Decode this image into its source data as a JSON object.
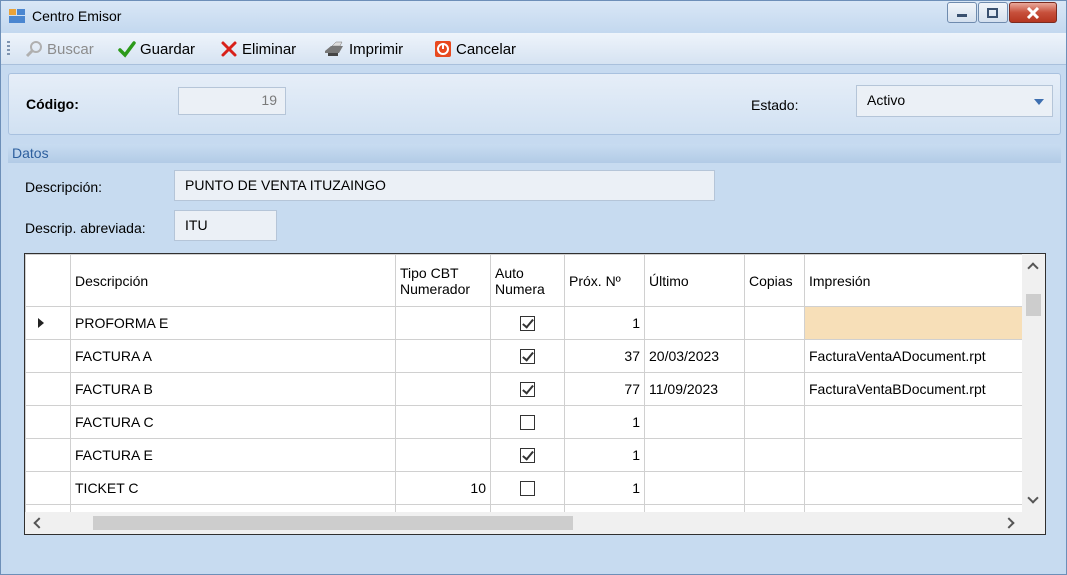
{
  "window": {
    "title": "Centro Emisor",
    "controls": {
      "minimize": "minimize",
      "maximize": "maximize",
      "close": "close"
    }
  },
  "toolbar": {
    "buscar": "Buscar",
    "guardar": "Guardar",
    "eliminar": "Eliminar",
    "imprimir": "Imprimir",
    "cancelar": "Cancelar"
  },
  "header": {
    "codigo_label": "Código:",
    "codigo_value": "19",
    "estado_label": "Estado:",
    "estado_value": "Activo"
  },
  "datos": {
    "section_title": "Datos",
    "descripcion_label": "Descripción:",
    "descripcion_value": "PUNTO DE VENTA ITUZAINGO",
    "abreviada_label": "Descrip. abreviada:",
    "abreviada_value": "ITU"
  },
  "grid": {
    "columns": {
      "descripcion": "Descripción",
      "tipo_l1": "Tipo CBT",
      "tipo_l2": "Numerador",
      "auto_l1": "Auto",
      "auto_l2": "Numera",
      "prox": "Próx. Nº",
      "ultimo": "Último",
      "copias": "Copias",
      "impresion": "Impresión"
    },
    "rows": [
      {
        "descripcion": "PROFORMA E",
        "tipo": "",
        "auto": true,
        "prox": "1",
        "ultimo": "",
        "copias": "",
        "impresion": ""
      },
      {
        "descripcion": "FACTURA A",
        "tipo": "",
        "auto": true,
        "prox": "37",
        "ultimo": "20/03/2023",
        "copias": "",
        "impresion": "FacturaVentaADocument.rpt"
      },
      {
        "descripcion": "FACTURA B",
        "tipo": "",
        "auto": true,
        "prox": "77",
        "ultimo": "11/09/2023",
        "copias": "",
        "impresion": "FacturaVentaBDocument.rpt"
      },
      {
        "descripcion": "FACTURA C",
        "tipo": "",
        "auto": false,
        "prox": "1",
        "ultimo": "",
        "copias": "",
        "impresion": ""
      },
      {
        "descripcion": "FACTURA E",
        "tipo": "",
        "auto": true,
        "prox": "1",
        "ultimo": "",
        "copias": "",
        "impresion": ""
      },
      {
        "descripcion": "TICKET C",
        "tipo": "10",
        "auto": false,
        "prox": "1",
        "ultimo": "",
        "copias": "",
        "impresion": ""
      }
    ]
  },
  "colors": {
    "window_bg": "#c6daf0",
    "section_title": "#2d5f9e",
    "selected_cell": "#f7dfb8",
    "close_button": "#c7503b"
  }
}
